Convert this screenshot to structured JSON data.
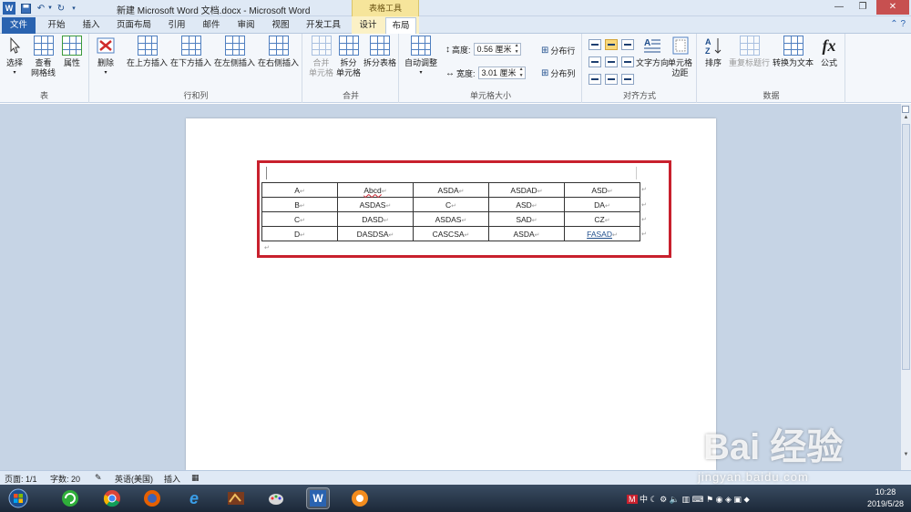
{
  "window": {
    "title": "新建 Microsoft Word 文档.docx - Microsoft Word",
    "context_tab_title": "表格工具"
  },
  "tabs": [
    "文件",
    "开始",
    "插入",
    "页面布局",
    "引用",
    "邮件",
    "审阅",
    "视图",
    "开发工具",
    "设计",
    "布局"
  ],
  "active_tab": "布局",
  "ribbon": {
    "groups": [
      {
        "label": "表",
        "buttons": [
          "选择",
          "查看网格线",
          "属性"
        ]
      },
      {
        "label": "行和列",
        "buttons": [
          "删除",
          "在上方插入",
          "在下方插入",
          "在左侧插入",
          "在右侧插入"
        ]
      },
      {
        "label": "合并",
        "buttons": [
          "合并单元格",
          "拆分单元格",
          "拆分表格"
        ]
      },
      {
        "label": "单元格大小",
        "buttons": [
          "自动调整"
        ]
      },
      {
        "label": "对齐方式",
        "buttons": [
          "文字方向",
          "单元格边距"
        ]
      },
      {
        "label": "数据",
        "buttons": [
          "排序",
          "重复标题行",
          "转换为文本",
          "公式"
        ]
      }
    ],
    "table_group": {
      "select": "选择",
      "gridlines_line1": "查看",
      "gridlines_line2": "网格线",
      "properties": "属性"
    },
    "rowscols": {
      "delete": "删除",
      "insert_above": "在上方插入",
      "insert_below": "在下方插入",
      "insert_left": "在左侧插入",
      "insert_right": "在右侧插入"
    },
    "merge": {
      "merge_line1": "合并",
      "merge_line2": "单元格",
      "split_line1": "拆分",
      "split_line2": "单元格",
      "split_table": "拆分表格"
    },
    "cellsize": {
      "autofit": "自动调整",
      "height_label": "高度:",
      "height_value": "0.56 厘米",
      "width_label": "宽度:",
      "width_value": "3.01 厘米",
      "distribute_rows": "分布行",
      "distribute_cols": "分布列"
    },
    "alignment": {
      "text_direction": "文字方向",
      "margins_line1": "单元格",
      "margins_line2": "边距"
    },
    "data": {
      "sort": "排序",
      "repeat_header": "重复标题行",
      "convert_text": "转换为文本",
      "formula": "公式",
      "formula_glyph": "fx"
    }
  },
  "document": {
    "table": [
      [
        "A",
        "Abcd",
        "ASDA",
        "ASDAD",
        "ASD"
      ],
      [
        "B",
        "ASDAS",
        "C",
        "ASD",
        "DA"
      ],
      [
        "C",
        "DASD",
        "ASDAS",
        "SAD",
        "CZ"
      ],
      [
        "D",
        "DASDSA",
        "CASCSA",
        "ASDA",
        "FASAD"
      ]
    ]
  },
  "statusbar": {
    "page": "页面: 1/1",
    "words": "字数: 20",
    "language": "英语(美国)",
    "mode": "插入"
  },
  "taskbar": {
    "tray_text": "中",
    "time": "10:28",
    "date": "2019/5/28"
  },
  "watermark": {
    "text": "Bai 经验",
    "sub": "jingyan.baidu.com"
  },
  "colors": {
    "accent": "#2a63b0",
    "highlight_box": "#c8202d",
    "context_tab": "#f6e59b"
  }
}
